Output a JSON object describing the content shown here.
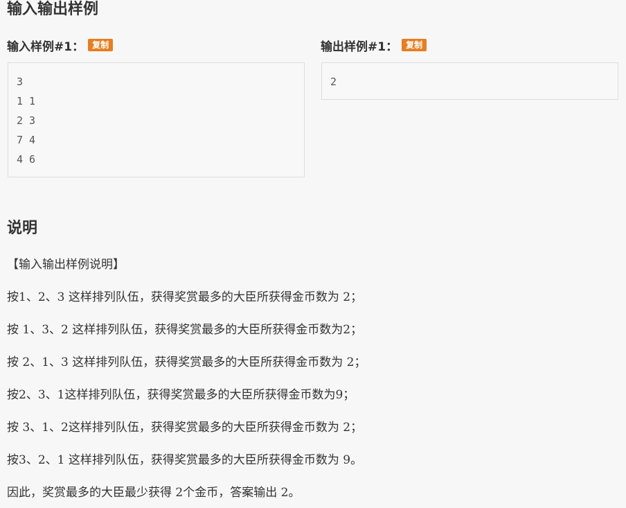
{
  "section_io": {
    "title": "输入输出样例"
  },
  "input_sample": {
    "label": "输入样例#1：",
    "copy_label": "复制",
    "lines": [
      "3",
      "1 1",
      "2 3",
      "7 4",
      "4 6"
    ]
  },
  "output_sample": {
    "label": "输出样例#1：",
    "copy_label": "复制",
    "lines": [
      "2"
    ]
  },
  "section_explanation": {
    "title": "说明",
    "paragraphs": [
      "【输入输出样例说明】",
      "按1、2、3 这样排列队伍，获得奖赏最多的大臣所获得金币数为 2；",
      "按 1、3、2 这样排列队伍，获得奖赏最多的大臣所获得金币数为2；",
      "按 2、1、3 这样排列队伍，获得奖赏最多的大臣所获得金币数为 2；",
      "按2、3、1这样排列队伍，获得奖赏最多的大臣所获得金币数为9；",
      "按 3、1、2这样排列队伍，获得奖赏最多的大臣所获得金币数为 2；",
      "按3、2、1 这样排列队伍，获得奖赏最多的大臣所获得金币数为 9。",
      "因此，奖赏最多的大臣最少获得 2个金币，答案输出 2。"
    ]
  },
  "colors": {
    "copy_button_bg": "#e67e22",
    "code_box_bg": "#f8f8f8",
    "page_bg": "#f7f7f7"
  }
}
